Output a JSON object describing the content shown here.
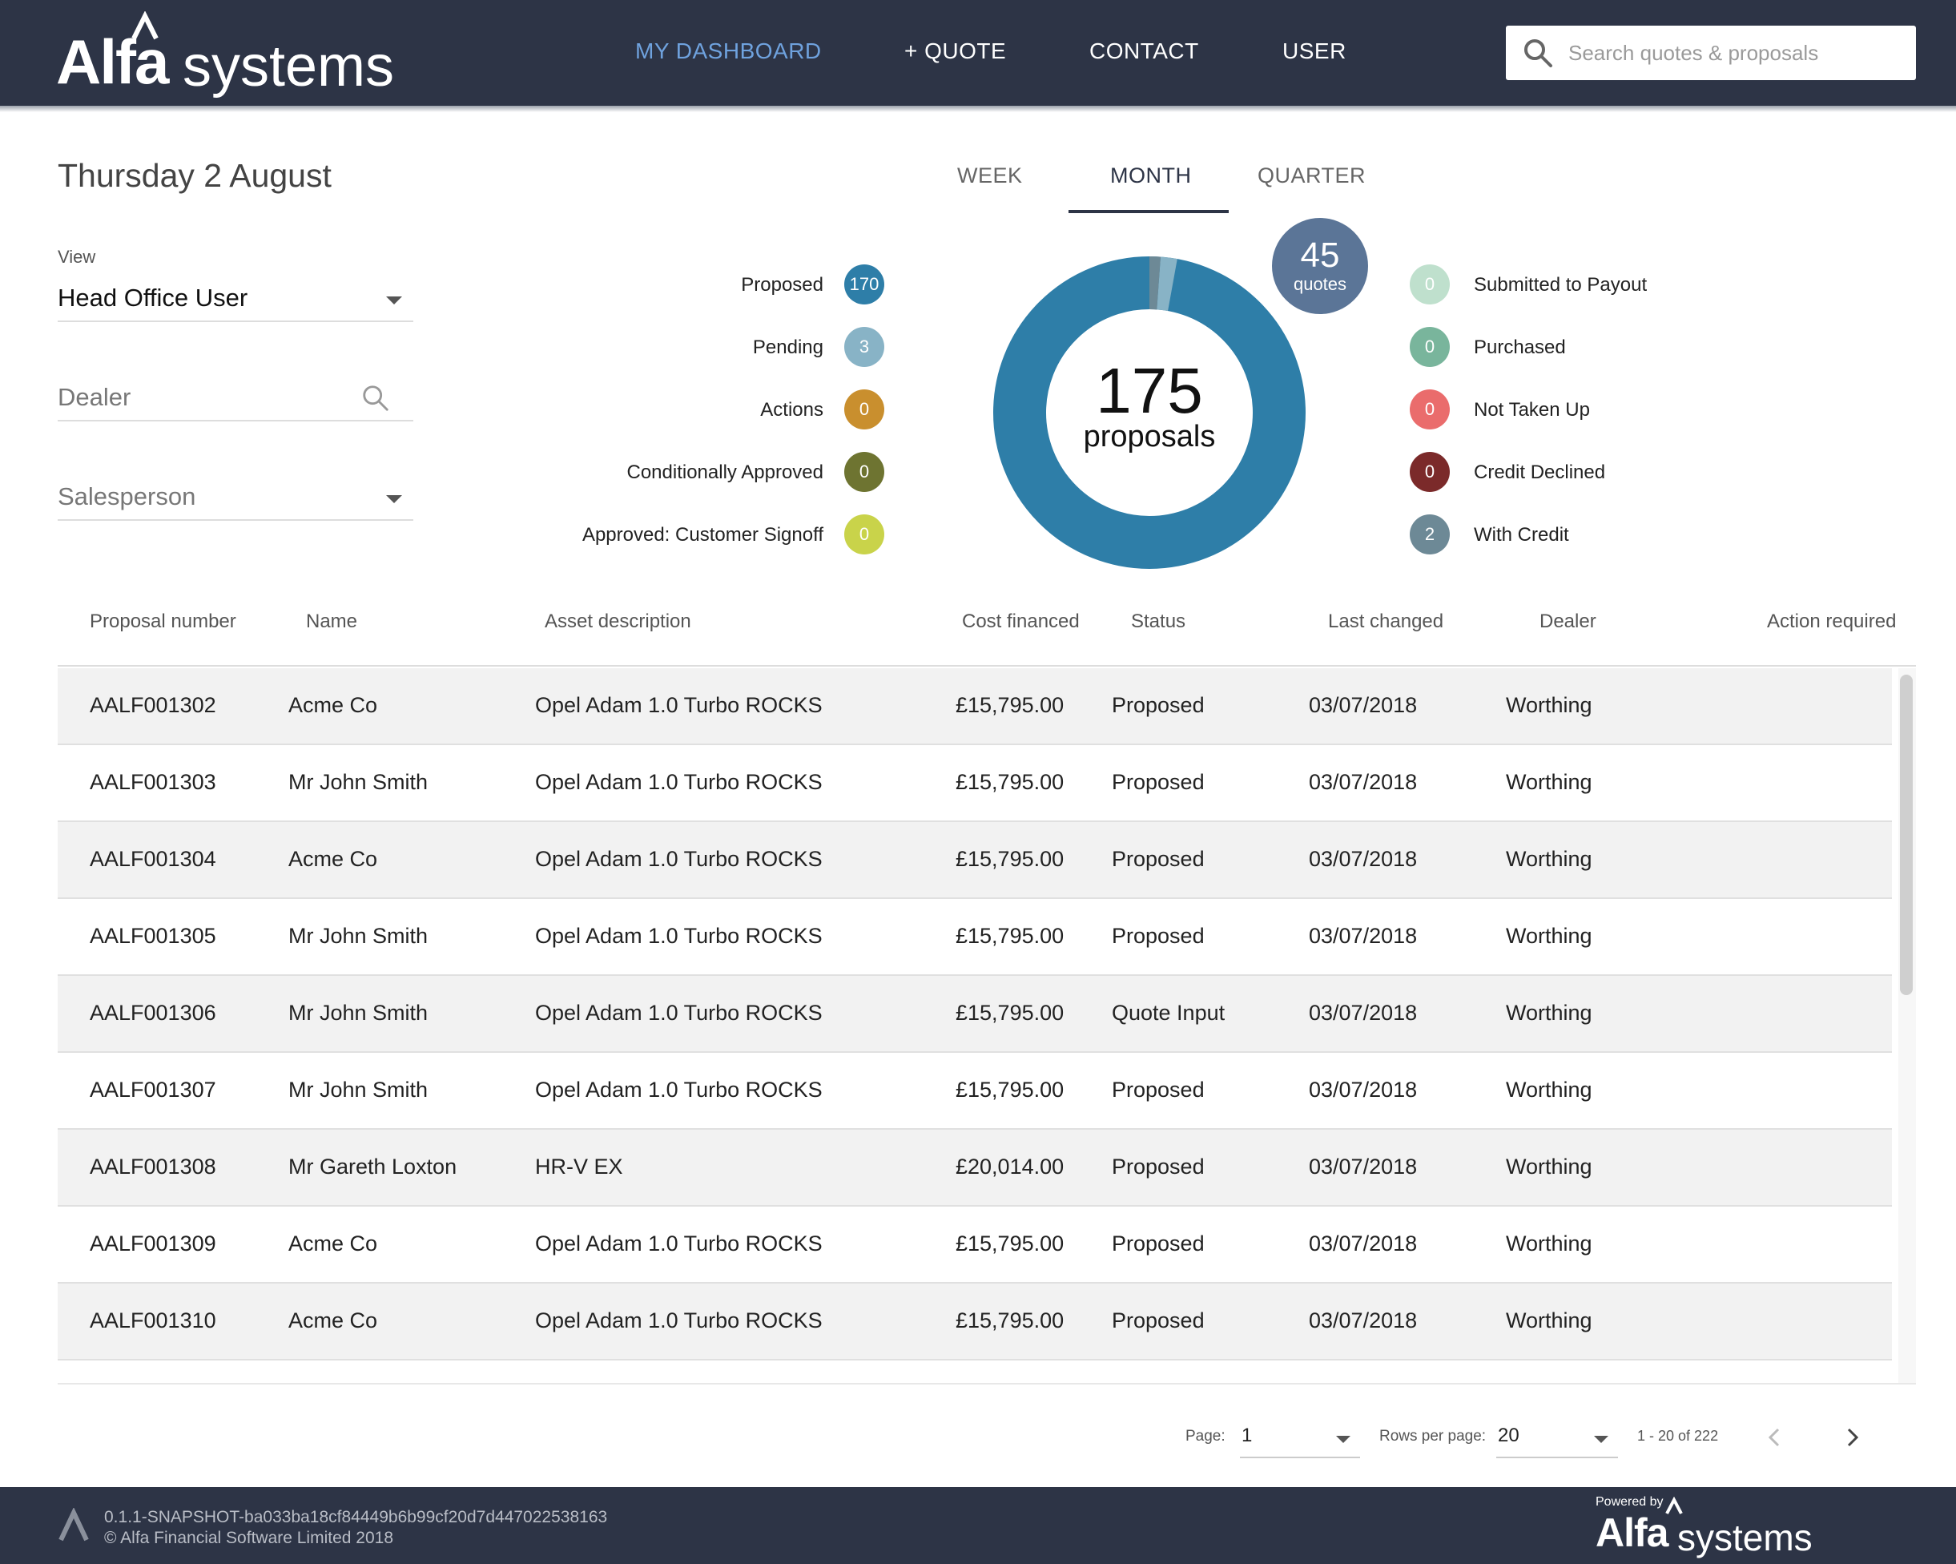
{
  "header": {
    "logo_alfa": "Alfa",
    "logo_systems": "systems",
    "nav": [
      {
        "label": "MY DASHBOARD",
        "active": true
      },
      {
        "label": "+ QUOTE",
        "active": false
      },
      {
        "label": "CONTACT",
        "active": false
      },
      {
        "label": "USER",
        "active": false
      }
    ],
    "search_placeholder": "Search quotes & proposals"
  },
  "filters": {
    "date": "Thursday 2 August",
    "view_label": "View",
    "view_value": "Head Office User",
    "dealer_placeholder": "Dealer",
    "salesperson_placeholder": "Salesperson"
  },
  "period_tabs": [
    {
      "label": "WEEK",
      "active": false
    },
    {
      "label": "MONTH",
      "active": true
    },
    {
      "label": "QUARTER",
      "active": false
    }
  ],
  "summary": {
    "left_statuses": [
      {
        "label": "Proposed",
        "count": "170",
        "color": "#2e7ea8"
      },
      {
        "label": "Pending",
        "count": "3",
        "color": "#88b3c6"
      },
      {
        "label": "Actions",
        "count": "0",
        "color": "#c98f2e"
      },
      {
        "label": "Conditionally Approved",
        "count": "0",
        "color": "#6e7431"
      },
      {
        "label": "Approved: Customer Signoff",
        "count": "0",
        "color": "#c9d34a"
      }
    ],
    "right_statuses": [
      {
        "label": "Submitted to Payout",
        "count": "0",
        "color": "#bfe0cd"
      },
      {
        "label": "Purchased",
        "count": "0",
        "color": "#79b59c"
      },
      {
        "label": "Not Taken Up",
        "count": "0",
        "color": "#ea6c6c"
      },
      {
        "label": "Credit Declined",
        "count": "0",
        "color": "#7b2a2a"
      },
      {
        "label": "With Credit",
        "count": "2",
        "color": "#6d8996"
      }
    ],
    "total_proposals": "175",
    "proposals_label": "proposals",
    "quotes_count": "45",
    "quotes_label": "quotes"
  },
  "table": {
    "columns": [
      "Proposal number",
      "Name",
      "Asset description",
      "Cost financed",
      "Status",
      "Last changed",
      "Dealer",
      "Action required"
    ],
    "rows": [
      [
        "AALF001302",
        "Acme Co",
        "Opel Adam 1.0 Turbo ROCKS",
        "£15,795.00",
        "Proposed",
        "03/07/2018",
        "Worthing",
        ""
      ],
      [
        "AALF001303",
        "Mr John Smith",
        "Opel Adam 1.0 Turbo ROCKS",
        "£15,795.00",
        "Proposed",
        "03/07/2018",
        "Worthing",
        ""
      ],
      [
        "AALF001304",
        "Acme Co",
        "Opel Adam 1.0 Turbo ROCKS",
        "£15,795.00",
        "Proposed",
        "03/07/2018",
        "Worthing",
        ""
      ],
      [
        "AALF001305",
        "Mr John Smith",
        "Opel Adam 1.0 Turbo ROCKS",
        "£15,795.00",
        "Proposed",
        "03/07/2018",
        "Worthing",
        ""
      ],
      [
        "AALF001306",
        "Mr John Smith",
        "Opel Adam 1.0 Turbo ROCKS",
        "£15,795.00",
        "Quote Input",
        "03/07/2018",
        "Worthing",
        ""
      ],
      [
        "AALF001307",
        "Mr John Smith",
        "Opel Adam 1.0 Turbo ROCKS",
        "£15,795.00",
        "Proposed",
        "03/07/2018",
        "Worthing",
        ""
      ],
      [
        "AALF001308",
        "Mr Gareth Loxton",
        "HR-V EX",
        "£20,014.00",
        "Proposed",
        "03/07/2018",
        "Worthing",
        ""
      ],
      [
        "AALF001309",
        "Acme Co",
        "Opel Adam 1.0 Turbo ROCKS",
        "£15,795.00",
        "Proposed",
        "03/07/2018",
        "Worthing",
        ""
      ],
      [
        "AALF001310",
        "Acme Co",
        "Opel Adam 1.0 Turbo ROCKS",
        "£15,795.00",
        "Proposed",
        "03/07/2018",
        "Worthing",
        ""
      ]
    ]
  },
  "pagination": {
    "page_label": "Page:",
    "page_value": "1",
    "rows_label": "Rows per page:",
    "rows_value": "20",
    "range": "1 - 20 of 222"
  },
  "footer": {
    "version": "0.1.1-SNAPSHOT-ba033ba18cf84449b6b99cf20d7d447022538163",
    "copyright": "© Alfa Financial Software Limited 2018",
    "powered_by": "Powered by",
    "logo_alfa": "Alfa",
    "logo_systems": "systems"
  }
}
